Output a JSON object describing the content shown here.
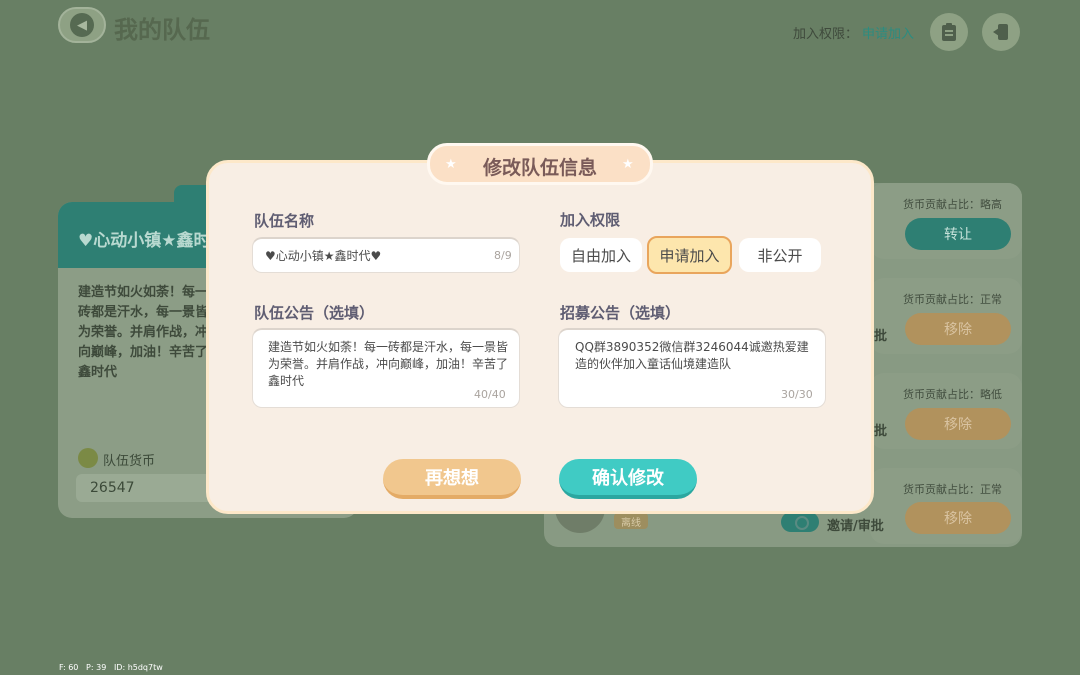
{
  "header": {
    "title": "我的队伍",
    "join_permission_label": "加入权限：",
    "join_permission_value": "申请加入"
  },
  "team_card": {
    "name": "♥心动小镇★鑫时代",
    "notice": "建造节如火如荼！每一砖都是汗水，每一景皆为荣誉。并肩作战，冲向巅峰，加油！辛苦了鑫时代",
    "currency_label": "队伍货币",
    "currency_value": "26547"
  },
  "members": [
    {
      "contribution": "货币贡献占比：略高",
      "action": "转让"
    },
    {
      "contribution": "货币贡献占比：正常",
      "action": "移除",
      "approve_suffix": "批"
    },
    {
      "contribution": "货币贡献占比：略低",
      "action": "移除",
      "approve_suffix": "批"
    },
    {
      "contribution": "货币贡献占比：正常",
      "action": "移除",
      "status": "离线",
      "approve_label": "邀请/审批"
    }
  ],
  "modal": {
    "title": "修改队伍信息",
    "team_name_label": "队伍名称",
    "team_name_value": "♥心动小镇★鑫时代♥",
    "team_name_count": "8/9",
    "permission_label": "加入权限",
    "permission_options": [
      "自由加入",
      "申请加入",
      "非公开"
    ],
    "permission_selected": "申请加入",
    "notice_label": "队伍公告（选填）",
    "notice_value": "建造节如火如荼！每一砖都是汗水，每一景皆为荣誉。并肩作战，冲向巅峰，加油！辛苦了鑫时代",
    "notice_count": "40/40",
    "recruit_label": "招募公告（选填）",
    "recruit_value": "QQ群3890352微信群3246044诚邀热爱建造的伙伴加入童话仙境建造队",
    "recruit_count": "30/30",
    "cancel_label": "再想想",
    "confirm_label": "确认修改"
  },
  "footer": {
    "fps": "F: 60",
    "p": "P: 39",
    "id": "ID: h5dq7tw"
  },
  "colors": {
    "backdrop": "#687f64",
    "accent_teal": "#40cbc4",
    "accent_orange": "#f1c78e",
    "modal_bg": "#f8eee4"
  }
}
